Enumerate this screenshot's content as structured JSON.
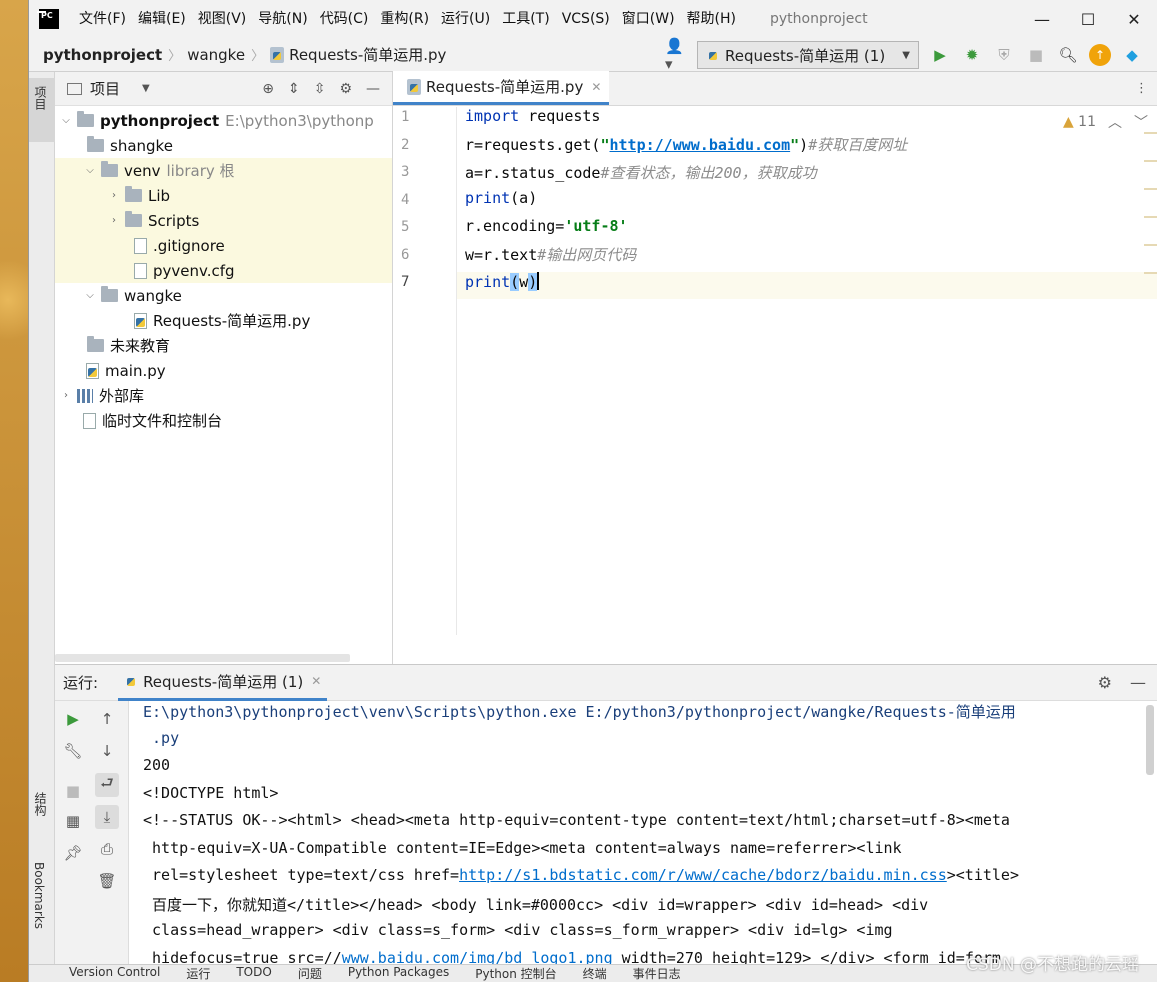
{
  "menu": {
    "items": [
      "文件(F)",
      "编辑(E)",
      "视图(V)",
      "导航(N)",
      "代码(C)",
      "重构(R)",
      "运行(U)",
      "工具(T)",
      "VCS(S)",
      "窗口(W)",
      "帮助(H)"
    ],
    "project_title": "pythonproject"
  },
  "breadcrumb": {
    "root": "pythonproject",
    "folder": "wangke",
    "file": "Requests-简单运用.py"
  },
  "toolbar": {
    "run_config": "Requests-简单运用 (1)"
  },
  "left_strip": {
    "project": "项目",
    "structure": "结构",
    "bookmarks": "Bookmarks"
  },
  "project_panel": {
    "title": "项目",
    "tree": [
      {
        "label": "pythonproject",
        "hint": "E:\\python3\\pythonp"
      },
      {
        "label": "shangke"
      },
      {
        "label": "venv",
        "hint": "library 根"
      },
      {
        "label": "Lib"
      },
      {
        "label": "Scripts"
      },
      {
        "label": ".gitignore"
      },
      {
        "label": "pyvenv.cfg"
      },
      {
        "label": "wangke"
      },
      {
        "label": "Requests-简单运用.py"
      },
      {
        "label": "未来教育"
      },
      {
        "label": "main.py"
      },
      {
        "label": "外部库"
      },
      {
        "label": "临时文件和控制台"
      }
    ]
  },
  "editor": {
    "tab": "Requests-简单运用.py",
    "warnings": "11",
    "line_numbers": [
      "1",
      "2",
      "3",
      "4",
      "5",
      "6",
      "7"
    ],
    "code": {
      "l1_kw": "import",
      "l1_rest": " requests",
      "l2_a": "r=requests.get(",
      "l2_q1": "\"",
      "l2_url": "http://www.baidu.com",
      "l2_q2": "\"",
      "l2_b": ")",
      "l2_cm": "#获取百度网址",
      "l3_a": "a=r.status_code",
      "l3_cm": "#查看状态，输出200，获取成功",
      "l4_fn": "print",
      "l4_rest": "(a)",
      "l5_a": "r.encoding=",
      "l5_str": "'utf-8'",
      "l6_a": "w=r.text",
      "l6_cm": "#输出网页代码",
      "l7_fn": "print",
      "l7_p1": "(",
      "l7_arg": "w",
      "l7_p2": ")"
    }
  },
  "run_panel": {
    "label": "运行:",
    "tab": "Requests-简单运用 (1)",
    "output": {
      "o1": "E:\\python3\\pythonproject\\venv\\Scripts\\python.exe E:/python3/pythonproject/wangke/Requests-简单运用",
      "o2": " .py",
      "o3": "200",
      "o4": "<!DOCTYPE html>",
      "o5": "<!--STATUS OK--><html> <head><meta http-equiv=content-type content=text/html;charset=utf-8><meta",
      "o6": " http-equiv=X-UA-Compatible content=IE=Edge><meta content=always name=referrer><link",
      "o7a": " rel=stylesheet type=text/css href=",
      "o7link": "http://s1.bdstatic.com/r/www/cache/bdorz/baidu.min.css",
      "o7b": "><title>",
      "o8": " 百度一下，你就知道</title></head> <body link=#0000cc> <div id=wrapper> <div id=head> <div",
      "o9": " class=head_wrapper> <div class=s_form> <div class=s_form_wrapper> <div id=lg> <img",
      "o10a": " hidefocus=true src=//",
      "o10link": "www.baidu.com/img/bd_logo1.png",
      "o10b": " width=270 height=129> </div> <form id=form"
    }
  },
  "bottom": {
    "items": [
      "Version Control",
      "运行",
      "TODO",
      "问题",
      "Python Packages",
      "Python 控制台",
      "终端",
      "事件日志"
    ]
  },
  "watermark": "CSDN @不想跑的云瑶"
}
